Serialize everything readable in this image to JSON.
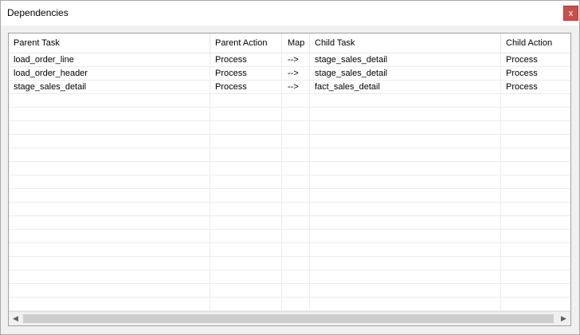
{
  "window": {
    "title": "Dependencies",
    "close_label": "x"
  },
  "grid": {
    "columns": [
      "Parent Task",
      "Parent Action",
      "Map",
      "Child Task",
      "Child Action"
    ],
    "rows": [
      [
        "load_order_line",
        "Process",
        "-->",
        "stage_sales_detail",
        "Process"
      ],
      [
        "load_order_header",
        "Process",
        "-->",
        "stage_sales_detail",
        "Process"
      ],
      [
        "stage_sales_detail",
        "Process",
        "-->",
        "fact_sales_detail",
        "Process"
      ]
    ]
  },
  "scrollbar": {
    "left_arrow_icon": "arrow-left-icon",
    "right_arrow_icon": "arrow-right-icon"
  }
}
